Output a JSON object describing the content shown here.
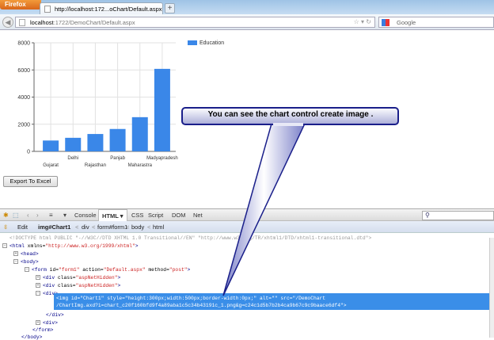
{
  "browser": {
    "menu_button": "Firefox",
    "tab_title": "http://localhost:172...oChart/Default.aspx",
    "new_tab": "+",
    "url_host": "localhost",
    "url_rest": ":1722/DemoChart/Default.aspx",
    "search_placeholder": "Google"
  },
  "page": {
    "export_button": "Export To Excel"
  },
  "chart_data": {
    "type": "bar",
    "categories": [
      "Gujarat",
      "Delhi",
      "Rajasthan",
      "Panjab",
      "Maharastra",
      "Madyapradesh"
    ],
    "series": [
      {
        "name": "Education",
        "values": [
          800,
          1000,
          1280,
          1650,
          2520,
          6080
        ],
        "color": "#3a87e8"
      }
    ],
    "yticks": [
      "0",
      "2000",
      "4000",
      "6000",
      "8000"
    ],
    "ylim": [
      0,
      8000
    ],
    "grid": true,
    "legend": "top-right"
  },
  "callout": {
    "text": "You can see the chart control create image ."
  },
  "firebug": {
    "tabs": [
      "Console",
      "HTML ▾",
      "CSS",
      "Script",
      "DOM",
      "Net"
    ],
    "active_tab": 1,
    "search_icon": "⚲",
    "edit": "Edit",
    "breadcrumb": [
      "img#Chart1",
      "<",
      "div",
      "<",
      "form#form1",
      "<",
      "body",
      "<",
      "html"
    ],
    "doctype": "<!DOCTYPE html PUBLIC \"-//W3C//DTD XHTML 1.0 Transitional//EN\" \"http://www.w3.org/TR/xhtml1/DTD/xhtml1-transitional.dtd\">",
    "html_open_tag": "<html",
    "html_xmlns_attr": " xmlns=",
    "html_xmlns_val": "\"http://www.w3.org/1999/xhtml\"",
    "head": "<head>",
    "body": "<body>",
    "form_tag": "<form",
    "form_id_attr": " id=",
    "form_id_val": "\"form1\"",
    "form_action_attr": " action=",
    "form_action_val": "\"Default.aspx\"",
    "form_method_attr": " method=",
    "form_method_val": "\"post\"",
    "div_class_tag": "<div",
    "div_class_attr": " class=",
    "div_class_val": "\"aspNetHidden\"",
    "div": "<div>",
    "img_line1": "<img id=\"Chart1\" style=\"height:300px;width:500px;border-width:0px;\" alt=\"\" src=\"/DemoChart",
    "img_line2": "/ChartImg.axd?i=chart_c20f160bfd9f4a89aba1c5c34b43191c_1.png&g=c24c1d5b7b2b4ca9b67c9c9baace6df4\">",
    "div_close": "</div>",
    "form_close": "</form>",
    "body_close": "</body>",
    "close_angle": ">"
  }
}
